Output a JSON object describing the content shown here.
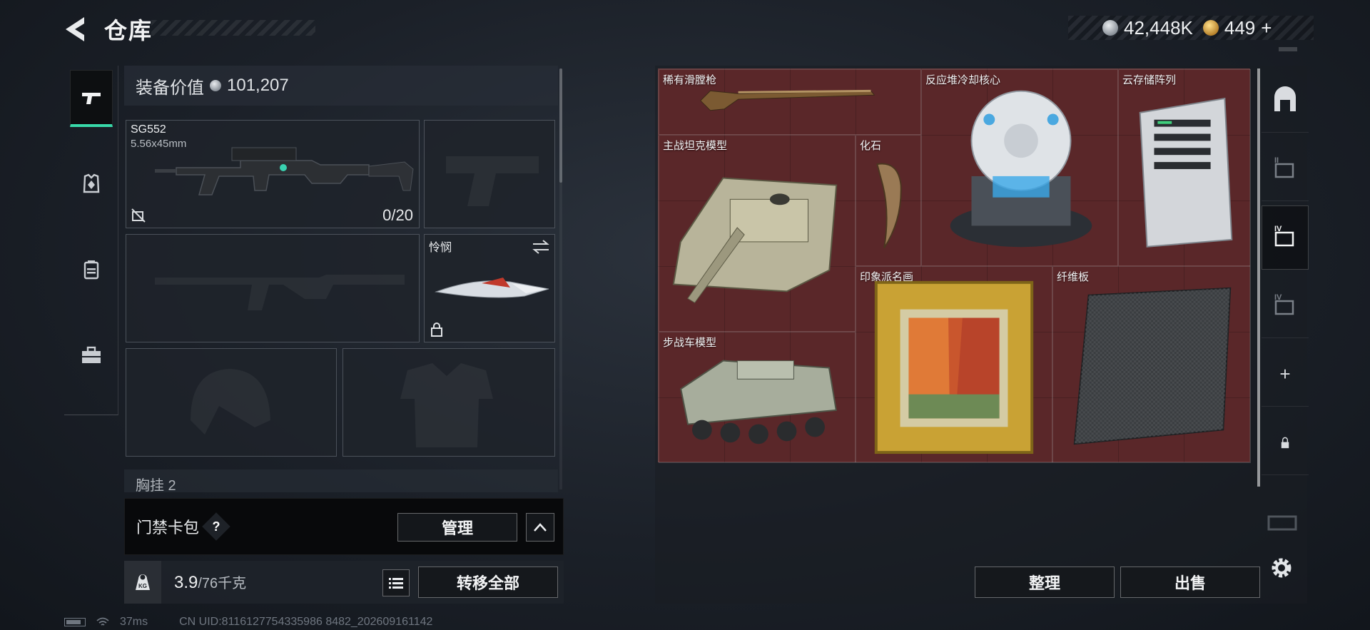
{
  "header": {
    "title": "仓库",
    "currency": [
      {
        "icon": "silver-coin-icon",
        "value": "42,448K"
      },
      {
        "icon": "gold-coin-icon",
        "value": "449",
        "suffix": "+"
      }
    ]
  },
  "side_nav": {
    "items": [
      {
        "icon": "pistol-icon",
        "active": true
      },
      {
        "icon": "armor-vest-icon",
        "active": false
      },
      {
        "icon": "backpack-icon",
        "active": false
      },
      {
        "icon": "toolbox-icon",
        "active": false
      }
    ]
  },
  "equipment": {
    "value_label": "装备价值",
    "value": "101,207",
    "primary_weapon": {
      "name": "SG552",
      "caliber": "5.56x45mm",
      "ammo": "0/20"
    },
    "melee": {
      "name": "怜悯"
    },
    "next_section": "胸挂 2"
  },
  "keycard": {
    "label": "门禁卡包",
    "help": "?",
    "manage_label": "管理"
  },
  "weight": {
    "icon_label": "KG",
    "current": "3.9",
    "max": "/76千克",
    "transfer_label": "转移全部"
  },
  "status": {
    "ping": "37ms",
    "uid": "CN UID:8116127754335986 8482_202609161142"
  },
  "stash": {
    "items": [
      {
        "name": "稀有滑膛枪"
      },
      {
        "name": "反应堆冷却核心"
      },
      {
        "name": "云存储阵列"
      },
      {
        "name": "主战坦克模型"
      },
      {
        "name": "化石"
      },
      {
        "name": "印象派名画"
      },
      {
        "name": "纤维板"
      },
      {
        "name": "步战车模型"
      }
    ],
    "sort_label": "整理",
    "sell_label": "出售"
  },
  "right_nav": {
    "items": [
      {
        "icon": "safe-box-icon"
      },
      {
        "icon": "stash-tier-2-icon",
        "label": "II"
      },
      {
        "icon": "stash-tier-4-icon",
        "label": "IV",
        "active": true
      },
      {
        "icon": "stash-tier-4-alt-icon",
        "label": "IV"
      },
      {
        "icon": "add-icon",
        "label": "+"
      },
      {
        "icon": "lock-icon"
      },
      {
        "icon": "stash-locked-icon"
      }
    ]
  },
  "colors": {
    "accent": "#38d9a9",
    "stash_bg": "#5a2729"
  }
}
